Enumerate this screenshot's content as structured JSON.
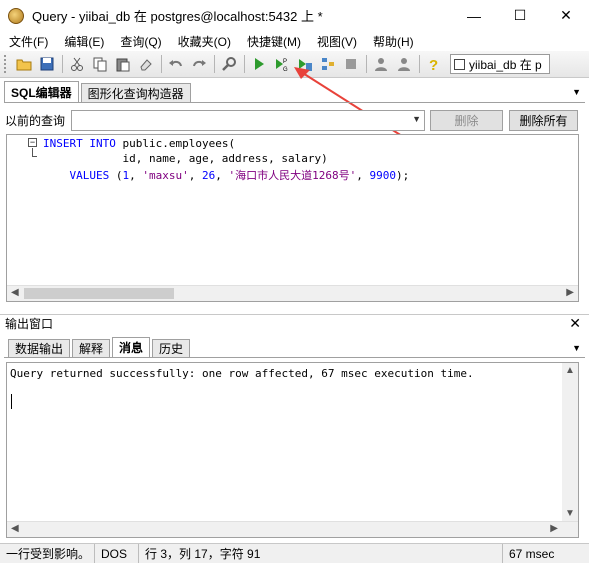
{
  "window": {
    "title": "Query - yiibai_db 在  postgres@localhost:5432 上 *",
    "minimize": "—",
    "maximize": "☐",
    "close": "✕"
  },
  "menu": [
    "文件(F)",
    "编辑(E)",
    "查询(Q)",
    "收藏夹(O)",
    "快捷键(M)",
    "视图(V)",
    "帮助(H)"
  ],
  "toolbar": {
    "database": "yiibai_db 在  p",
    "icons": [
      "open-icon",
      "save-icon",
      "cut-icon",
      "copy-icon",
      "paste-icon",
      "eraser-icon",
      "undo-icon",
      "redo-icon",
      "find-icon",
      "execute-icon",
      "execute-pgscript-icon",
      "execute-to-file-icon",
      "explain-icon",
      "stop-icon",
      "explain-analyze-icon",
      "commit-icon",
      "help-icon"
    ]
  },
  "editor_tabs": [
    "SQL编辑器",
    "图形化查询构造器"
  ],
  "history": {
    "label": "以前的查询",
    "delete": "删除",
    "delete_all": "删除所有"
  },
  "code": {
    "line1_kw": "INSERT INTO",
    "line1_rest": " public.employees(",
    "line2": "            id, name, age, address, salary)",
    "line3_kw": "    VALUES",
    "line3_open": " (",
    "line3_n1": "1",
    "line3_c1": ", ",
    "line3_s1": "'maxsu'",
    "line3_c2": ", ",
    "line3_n2": "26",
    "line3_c3": ", ",
    "line3_s2": "'海口市人民大道1268号'",
    "line3_c4": ", ",
    "line3_n3": "9900",
    "line3_end": ");"
  },
  "output": {
    "title": "输出窗口",
    "close": "✕",
    "tabs": [
      "数据输出",
      "解释",
      "消息",
      "历史"
    ],
    "active_tab": "消息",
    "message": "Query returned successfully: one row affected, 67 msec execution time."
  },
  "status": {
    "message": "一行受到影响。",
    "encoding": "DOS",
    "position": "行 3，列 17，字符 91",
    "time": "67 msec"
  },
  "colors": {
    "keyword": "#0000ff",
    "string": "#800080",
    "annotation_arrow": "#e8423a"
  }
}
